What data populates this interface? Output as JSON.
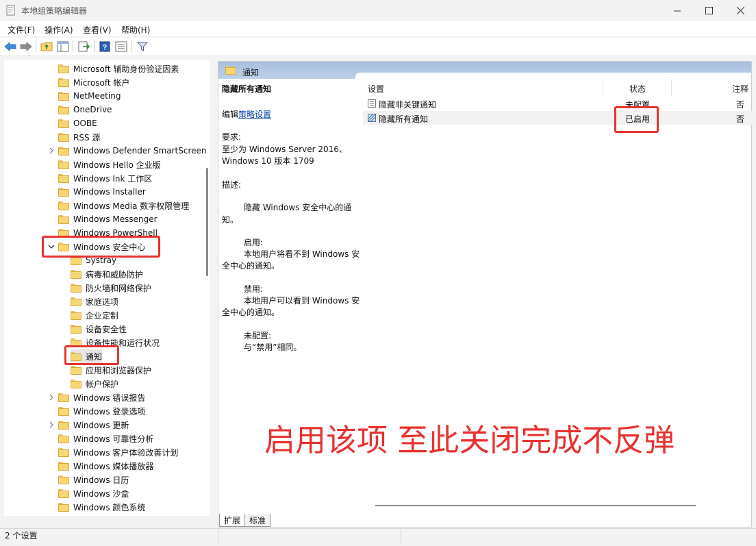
{
  "window": {
    "title": "本地组策略编辑器",
    "icon": "policy-editor-icon",
    "controls": [
      "minimize-icon",
      "maximize-icon",
      "close-icon"
    ]
  },
  "menu": [
    "文件(F)",
    "操作(A)",
    "查看(V)",
    "帮助(H)"
  ],
  "toolbar_icons": [
    "back-arrow-icon",
    "forward-arrow-icon",
    "up-folder-icon",
    "show-hide-tree-icon",
    "export-list-icon",
    "help-icon",
    "properties-icon",
    "filter-icon"
  ],
  "tree": {
    "items": [
      {
        "label": "Microsoft 辅助身份验证因素",
        "level": 0,
        "expandable": false
      },
      {
        "label": "Microsoft 帐户",
        "level": 0,
        "expandable": false
      },
      {
        "label": "NetMeeting",
        "level": 0,
        "expandable": false
      },
      {
        "label": "OneDrive",
        "level": 0,
        "expandable": false
      },
      {
        "label": "OOBE",
        "level": 0,
        "expandable": false
      },
      {
        "label": "RSS 源",
        "level": 0,
        "expandable": false
      },
      {
        "label": "Windows Defender SmartScreen",
        "level": 0,
        "expandable": true
      },
      {
        "label": "Windows Hello 企业版",
        "level": 0,
        "expandable": false
      },
      {
        "label": "Windows Ink 工作区",
        "level": 0,
        "expandable": false
      },
      {
        "label": "Windows Installer",
        "level": 0,
        "expandable": false
      },
      {
        "label": "Windows Media 数字权限管理",
        "level": 0,
        "expandable": false
      },
      {
        "label": "Windows Messenger",
        "level": 0,
        "expandable": false
      },
      {
        "label": "Windows PowerShell",
        "level": 0,
        "expandable": false
      },
      {
        "label": "Windows 安全中心",
        "level": 0,
        "expandable": true,
        "expanded": true
      },
      {
        "label": "Systray",
        "level": 1,
        "expandable": false
      },
      {
        "label": "病毒和威胁防护",
        "level": 1,
        "expandable": false
      },
      {
        "label": "防火墙和网络保护",
        "level": 1,
        "expandable": false
      },
      {
        "label": "家庭选项",
        "level": 1,
        "expandable": false
      },
      {
        "label": "企业定制",
        "level": 1,
        "expandable": false
      },
      {
        "label": "设备安全性",
        "level": 1,
        "expandable": false
      },
      {
        "label": "设备性能和运行状况",
        "level": 1,
        "expandable": false
      },
      {
        "label": "通知",
        "level": 1,
        "expandable": false,
        "selected": true
      },
      {
        "label": "应用和浏览器保护",
        "level": 1,
        "expandable": false
      },
      {
        "label": "帐户保护",
        "level": 1,
        "expandable": false
      },
      {
        "label": "Windows 错误报告",
        "level": 0,
        "expandable": true
      },
      {
        "label": "Windows 登录选项",
        "level": 0,
        "expandable": false
      },
      {
        "label": "Windows 更新",
        "level": 0,
        "expandable": true
      },
      {
        "label": "Windows 可靠性分析",
        "level": 0,
        "expandable": false
      },
      {
        "label": "Windows 客户体验改善计划",
        "level": 0,
        "expandable": false
      },
      {
        "label": "Windows 媒体播放器",
        "level": 0,
        "expandable": false
      },
      {
        "label": "Windows 日历",
        "level": 0,
        "expandable": false
      },
      {
        "label": "Windows 沙盒",
        "level": 0,
        "expandable": false
      },
      {
        "label": "Windows 颜色系统",
        "level": 0,
        "expandable": false
      }
    ]
  },
  "detail": {
    "header": "通知",
    "policy_title": "隐藏所有通知",
    "edit_prefix": "编辑",
    "edit_link": "策略设置",
    "requirements_label": "要求:",
    "requirements_line1": "至少为 Windows Server 2016、",
    "requirements_line2": "Windows 10 版本 1709",
    "description_label": "描述:",
    "desc_line1": "隐藏 Windows 安全中心的通",
    "desc_line2": "知。",
    "enabled_label": "启用:",
    "enabled_line1": "本地用户将看不到 Windows 安",
    "enabled_line2": "全中心的通知。",
    "disabled_label": "禁用:",
    "disabled_line1": "本地用户可以看到 Windows 安",
    "disabled_line2": "全中心的通知。",
    "notconfigured_label": "未配置:",
    "notconfigured_line1": "与“禁用”相同。"
  },
  "list": {
    "columns": [
      "设置",
      "状态",
      "注释"
    ],
    "rows": [
      {
        "setting": "隐藏非关键通知",
        "state": "未配置",
        "comment": "否",
        "icon": "policy-setting-icon"
      },
      {
        "setting": "隐藏所有通知",
        "state": "已启用",
        "comment": "否",
        "icon": "policy-setting-enabled-icon"
      }
    ]
  },
  "tabs": [
    "扩展",
    "标准"
  ],
  "status": "2 个设置",
  "annotation": "启用该项  至此关闭完成不反弹",
  "colors": {
    "annotation_red": "#e8322f",
    "header_blue": "#b4c8e4",
    "link_blue": "#0645ad"
  }
}
